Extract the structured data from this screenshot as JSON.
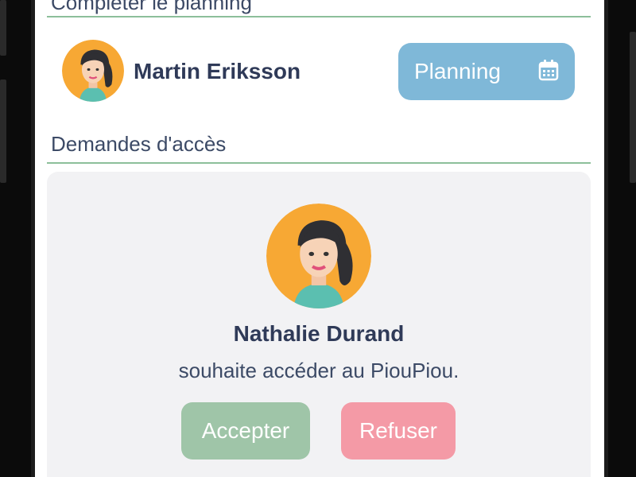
{
  "sections": {
    "top_title": "Compléter le planning",
    "requests_title": "Demandes d'accès"
  },
  "planning_row": {
    "user_name": "Martin Eriksson",
    "button_label": "Planning",
    "button_icon": "calendar-icon"
  },
  "access_request": {
    "name": "Nathalie Durand",
    "message": "souhaite accéder au PiouPiou.",
    "accept_label": "Accepter",
    "refuse_label": "Refuser"
  },
  "colors": {
    "divider": "#8cbf9a",
    "planning_button": "#7fb8d8",
    "accept": "#9fc5a8",
    "refuse": "#f49aa6",
    "card": "#f2f2f4",
    "avatar_bg": "#f7a834",
    "text": "#2f3a58"
  }
}
